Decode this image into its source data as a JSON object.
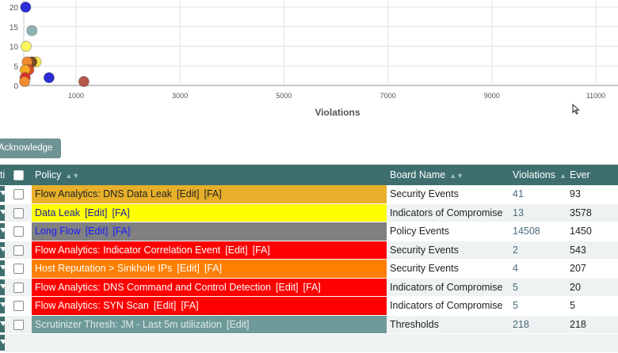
{
  "chart_data": {
    "type": "scatter",
    "xlabel": "Violations",
    "ylabel": "",
    "xlim": [
      0,
      11500
    ],
    "ylim": [
      0,
      22
    ],
    "x_ticks": [
      1000,
      3000,
      5000,
      7000,
      9000,
      11000
    ],
    "y_ticks": [
      0,
      5,
      10,
      15,
      20
    ],
    "grid": true,
    "points": [
      {
        "x": 30,
        "y": 20,
        "color": "#2c2cd6"
      },
      {
        "x": 150,
        "y": 14,
        "color": "#8fb3b3"
      },
      {
        "x": 40,
        "y": 10,
        "color": "#fbf95f"
      },
      {
        "x": 230,
        "y": 6,
        "color": "#f6e94a"
      },
      {
        "x": 150,
        "y": 6,
        "color": "#7a4a1f"
      },
      {
        "x": 60,
        "y": 6,
        "color": "#f28b30"
      },
      {
        "x": 90,
        "y": 4,
        "color": "#e04a2a"
      },
      {
        "x": 20,
        "y": 4,
        "color": "#f5a623"
      },
      {
        "x": 20,
        "y": 2,
        "color": "#e03030"
      },
      {
        "x": 10,
        "y": 1,
        "color": "#f28b30"
      },
      {
        "x": 480,
        "y": 2,
        "color": "#2c2cd6"
      },
      {
        "x": 1150,
        "y": 1,
        "color": "#b5594a"
      }
    ]
  },
  "toolbar": {
    "acknowledge_label": "Acknowledge"
  },
  "table": {
    "headers": {
      "status": "ti",
      "policy": "Policy",
      "board": "Board Name",
      "violations": "Violations",
      "events": "Ever"
    },
    "sort_glyph": "▲▼",
    "rows": [
      {
        "policy": "Flow Analytics: DNS Data Leak",
        "edit": "[Edit]",
        "fa": "[FA]",
        "board": "Security Events",
        "violations": "41",
        "events": "93",
        "bg": "#e8b02a",
        "fg": "#222222"
      },
      {
        "policy": "Data Leak",
        "edit": "[Edit]",
        "fa": "[FA]",
        "board": "Indicators of Compromise",
        "violations": "13",
        "events": "3578",
        "bg": "#ffff00",
        "fg": "#1a1aa8"
      },
      {
        "policy": "Long Flow",
        "edit": "[Edit]",
        "fa": "[FA]",
        "board": "Policy Events",
        "violations": "14508",
        "events": "1450",
        "bg": "#808080",
        "fg": "#1a1aff"
      },
      {
        "policy": "Flow Analytics: Indicator Correlation Event",
        "edit": "[Edit]",
        "fa": "[FA]",
        "board": "Security Events",
        "violations": "2",
        "events": "543",
        "bg": "#ff0000",
        "fg": "#ffffff"
      },
      {
        "policy": "Host Reputation > Sinkhole IPs",
        "edit": "[Edit]",
        "fa": "[FA]",
        "board": "Security Events",
        "violations": "4",
        "events": "207",
        "bg": "#ff7f00",
        "fg": "#ffffff"
      },
      {
        "policy": "Flow Analytics: DNS Command and Control Detection",
        "edit": "[Edit]",
        "fa": "[FA]",
        "board": "Indicators of Compromise",
        "violations": "5",
        "events": "20",
        "bg": "#ff0000",
        "fg": "#ffffff"
      },
      {
        "policy": "Flow Analytics: SYN Scan",
        "edit": "[Edit]",
        "fa": "[FA]",
        "board": "Indicators of Compromise",
        "violations": "5",
        "events": "5",
        "bg": "#ff0000",
        "fg": "#ffffff"
      },
      {
        "policy": "Scrutinizer Thresh: JM - Last 5m utilization",
        "edit": "[Edit]",
        "fa": "",
        "board": "Thresholds",
        "violations": "218",
        "events": "218",
        "bg": "#6f9a9a",
        "fg": "#dfeaea"
      }
    ]
  }
}
